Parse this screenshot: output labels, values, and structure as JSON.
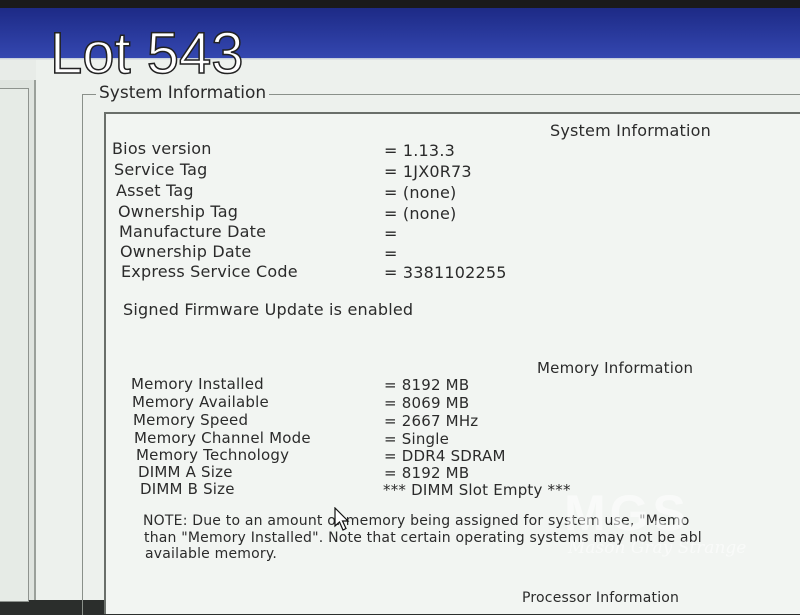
{
  "overlay": {
    "lot_label": "Lot 543",
    "watermark_logo": "MGS",
    "watermark_name": "Mason Gray Strange"
  },
  "group_title": "System Information",
  "system_info": {
    "heading": "System Information",
    "rows": [
      {
        "label": "Bios version",
        "value": "= 1.13.3"
      },
      {
        "label": "Service Tag",
        "value": "= 1JX0R73"
      },
      {
        "label": "Asset Tag",
        "value": "= (none)"
      },
      {
        "label": "Ownership Tag",
        "value": "= (none)"
      },
      {
        "label": "Manufacture Date",
        "value": "="
      },
      {
        "label": "Ownership Date",
        "value": "="
      },
      {
        "label": "Express Service Code",
        "value": "= 3381102255"
      }
    ],
    "firmware_note": "Signed Firmware Update is enabled"
  },
  "memory_info": {
    "heading": "Memory Information",
    "rows": [
      {
        "label": "Memory Installed",
        "value": "= 8192 MB"
      },
      {
        "label": "Memory Available",
        "value": "= 8069 MB"
      },
      {
        "label": "Memory Speed",
        "value": "= 2667 MHz"
      },
      {
        "label": "Memory Channel Mode",
        "value": "= Single"
      },
      {
        "label": "Memory Technology",
        "value": "= DDR4 SDRAM"
      },
      {
        "label": "DIMM A Size",
        "value": "= 8192 MB"
      },
      {
        "label": "DIMM B Size",
        "value": "*** DIMM Slot Empty ***"
      }
    ],
    "note_lines": [
      "NOTE: Due to an amount of memory being assigned for system use, \"Memo",
      "than \"Memory Installed\". Note that certain operating systems may not be abl",
      "available memory."
    ]
  },
  "processor_heading_partial": "Processor Information"
}
